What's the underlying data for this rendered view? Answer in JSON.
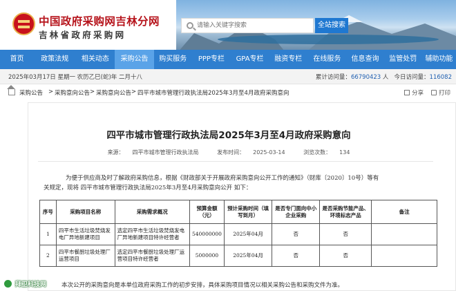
{
  "header": {
    "site_title": "中国政府采购网吉林分网",
    "site_subtitle": "吉林省政府采购网",
    "search": {
      "placeholder": "请输入关键字搜索",
      "button_label": "全站搜索"
    }
  },
  "nav": {
    "items": [
      {
        "label": "首页",
        "active": false
      },
      {
        "label": "政策法规",
        "active": false
      },
      {
        "label": "相关动态",
        "active": false
      },
      {
        "label": "采购公告",
        "active": true
      },
      {
        "label": "购买服务",
        "active": false
      },
      {
        "label": "PPP专栏",
        "active": false
      },
      {
        "label": "GPA专栏",
        "active": false
      },
      {
        "label": "融资专栏",
        "active": false
      },
      {
        "label": "在线服务",
        "active": false
      },
      {
        "label": "信息查询",
        "active": false
      },
      {
        "label": "监管处罚",
        "active": false
      },
      {
        "label": "辅助功能",
        "active": false
      }
    ]
  },
  "datebar": {
    "date": "2025年03月17日 星期一 农历乙巳(蛇)年 二月十八",
    "visits_label": "累计访问量：",
    "visits_value": "66790423",
    "unit": "人",
    "today_label": "今日访问量：",
    "today_value": "116082"
  },
  "breadcrumb": {
    "items": [
      "采购公告",
      "采购意向公告",
      "采购意向公告",
      "四平市城市管理行政执法局2025年3月至4月政府采购意向"
    ],
    "separator": ">",
    "share_label": "分享",
    "print_label": "打印"
  },
  "article": {
    "title": "四平市城市管理行政执法局2025年3月至4月政府采购意向",
    "source_label": "来源：",
    "source": "四平市城市管理行政执法局",
    "date_label": "发布时间：",
    "date": "2025-03-14",
    "views_label": "浏览次数：",
    "views": "134",
    "intro_line1": "为便于供应商及时了解政府采购信息，根据《财政部关于开展政府采购意向公开工作的通知》（财库〔2020〕10号）等有",
    "intro_line2": "关规定，现将      四平市城市管理行政执法局2025年3月至4月采购意向公开  如下：",
    "table": {
      "headers": [
        "序号",
        "采购项目名称",
        "采购需求概况",
        "预算金额（元）",
        "预计采购时间（填写到月）",
        "是否专门面向中小企业采购",
        "是否采购节能产品、环境标志产品",
        "备注"
      ],
      "rows": [
        [
          "1",
          "四平市生活垃圾焚烧发电厂异地新建项目",
          "选定四平市生活垃圾焚烧发电厂异地新建项目特许经营者",
          "540000000",
          "2025年04月",
          "否",
          "否",
          ""
        ],
        [
          "2",
          "四平市餐厨垃圾处理厂运营项目",
          "选定四平市餐厨垃圾处理厂运营项目特许经营者",
          "5000000",
          "2025年04月",
          "否",
          "否",
          ""
        ]
      ]
    },
    "footer_note": "本次公开的采购意向是本单位政府采购工作的初步安排，具体采购项目情况以相关采购公告和采购文件为准。"
  },
  "watermark": {
    "text": "拜卫科技网"
  },
  "colors": {
    "brand_red": "#b6131b",
    "nav_blue": "#2f7fcf",
    "nav_active": "#5aa3e8",
    "search_button": "#1f78d1",
    "count_blue": "#1f5fb0"
  }
}
